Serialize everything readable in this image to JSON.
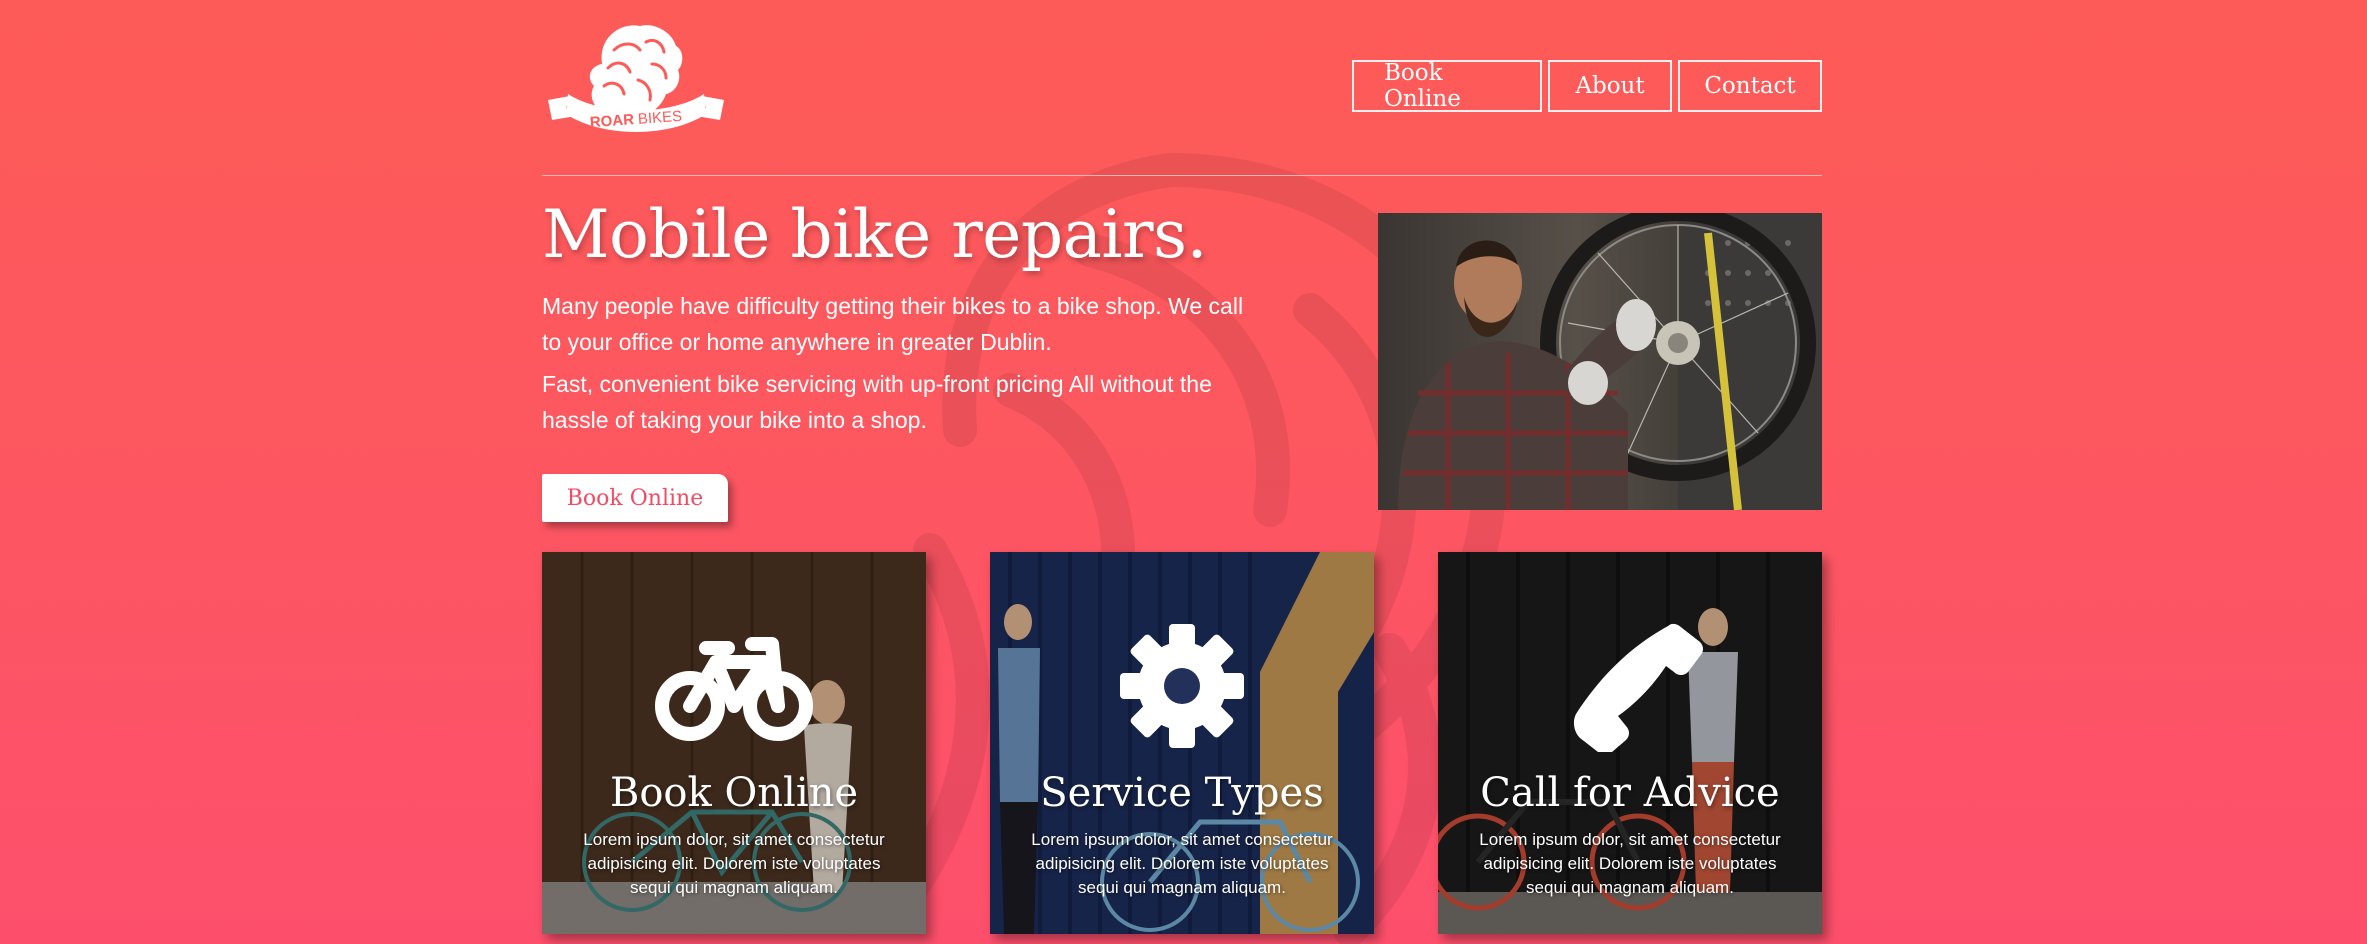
{
  "brand": {
    "logo_text_bold": "ROAR",
    "logo_text_light": "BIKES"
  },
  "nav": {
    "items": [
      {
        "label": "Book Online"
      },
      {
        "label": "About"
      },
      {
        "label": "Contact"
      }
    ]
  },
  "hero": {
    "title": "Mobile bike repairs.",
    "paragraph1": "Many people have difficulty getting their bikes to a bike shop. We call to your office or home anywhere in greater Dublin.",
    "paragraph2": "Fast, convenient bike servicing with up-front pricing All without the hassle of taking your bike into a shop.",
    "cta_label": "Book Online"
  },
  "cards": [
    {
      "title": "Book Online",
      "icon": "bicycle-icon",
      "text": "Lorem ipsum dolor, sit amet consectetur adipisicing elit. Dolorem iste voluptates sequi qui magnam aliquam."
    },
    {
      "title": "Service Types",
      "icon": "gear-icon",
      "text": "Lorem ipsum dolor, sit amet consectetur adipisicing elit. Dolorem iste voluptates sequi qui magnam aliquam."
    },
    {
      "title": "Call for Advice",
      "icon": "phone-icon",
      "text": "Lorem ipsum dolor, sit amet consectetur adipisicing elit. Dolorem iste voluptates sequi qui magnam aliquam."
    }
  ],
  "colors": {
    "background_top": "#fd5b57",
    "background_bottom": "#fd4f6c",
    "accent_text": "#f04c63"
  }
}
